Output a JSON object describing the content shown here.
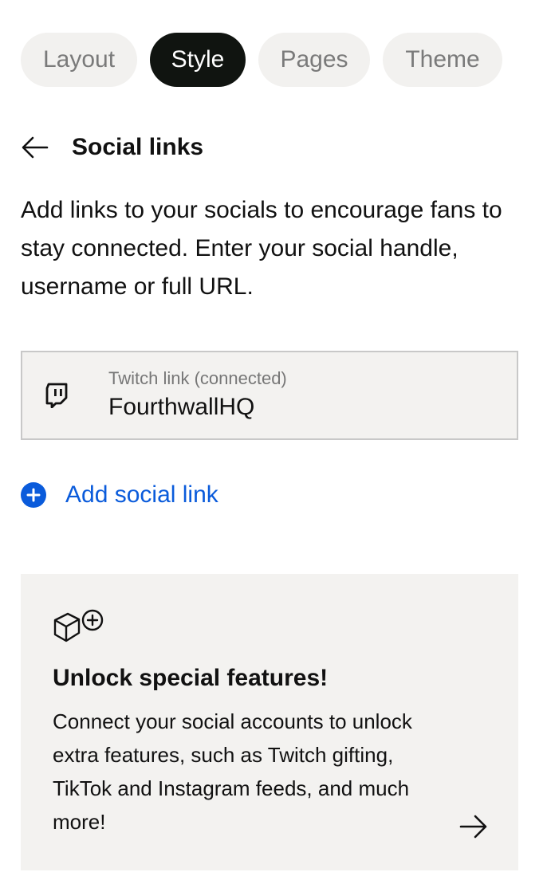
{
  "tabs": [
    {
      "label": "Layout",
      "active": false
    },
    {
      "label": "Style",
      "active": true
    },
    {
      "label": "Pages",
      "active": false
    },
    {
      "label": "Theme",
      "active": false
    }
  ],
  "header": {
    "back_icon": "arrow-left-icon",
    "title": "Social links"
  },
  "description": "Add links to your socials to encourage fans to stay connected. Enter your social handle, username or full URL.",
  "social_links": [
    {
      "icon": "twitch-icon",
      "label": "Twitch link (connected)",
      "value": "FourthwallHQ"
    }
  ],
  "add_link": {
    "icon": "plus-circle-icon",
    "label": "Add social link"
  },
  "promo": {
    "icon": "box-plus-icon",
    "title": "Unlock special features!",
    "text": "Connect your social accounts to unlock extra features, such as Twitch gifting, TikTok and Instagram feeds, and much more!",
    "arrow_icon": "arrow-right-icon"
  },
  "colors": {
    "accent_blue": "#0a5bdb",
    "active_tab_bg": "#101410",
    "tab_bg": "#f2f1ef",
    "panel_bg": "#f3f2f0"
  }
}
